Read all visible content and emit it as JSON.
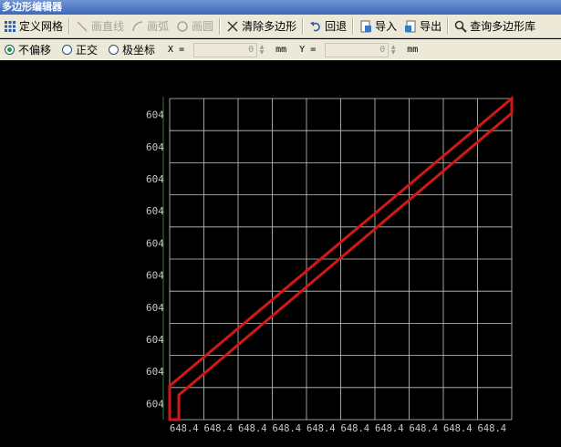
{
  "window": {
    "title": "多边形编辑器"
  },
  "toolbar": {
    "define_grid": "定义网格",
    "draw_line": "画直线",
    "draw_arc": "画弧",
    "draw_circle": "画圆",
    "clear_polygon": "清除多边形",
    "undo": "回退",
    "import": "导入",
    "export": "导出",
    "query_library": "查询多边形库"
  },
  "options": {
    "no_offset": "不偏移",
    "orthogonal": "正交",
    "polar": "极坐标",
    "selected": "不偏移",
    "x_label": "X =",
    "x_value": "0",
    "x_unit": "mm",
    "y_label": "Y =",
    "y_value": "0",
    "y_unit": "mm"
  },
  "grid": {
    "y_tick_labels": [
      "604",
      "604",
      "604",
      "604",
      "604",
      "604",
      "604",
      "604",
      "604",
      "604"
    ],
    "x_tick_labels": [
      "648.4",
      "648.4",
      "648.4",
      "648.4",
      "648.4",
      "648.4",
      "648.4",
      "648.4",
      "648.4",
      "648.4"
    ],
    "grid_color": "#c8c8c8",
    "polygon_color": "#d01818",
    "label_color": "#c8c8c8"
  }
}
